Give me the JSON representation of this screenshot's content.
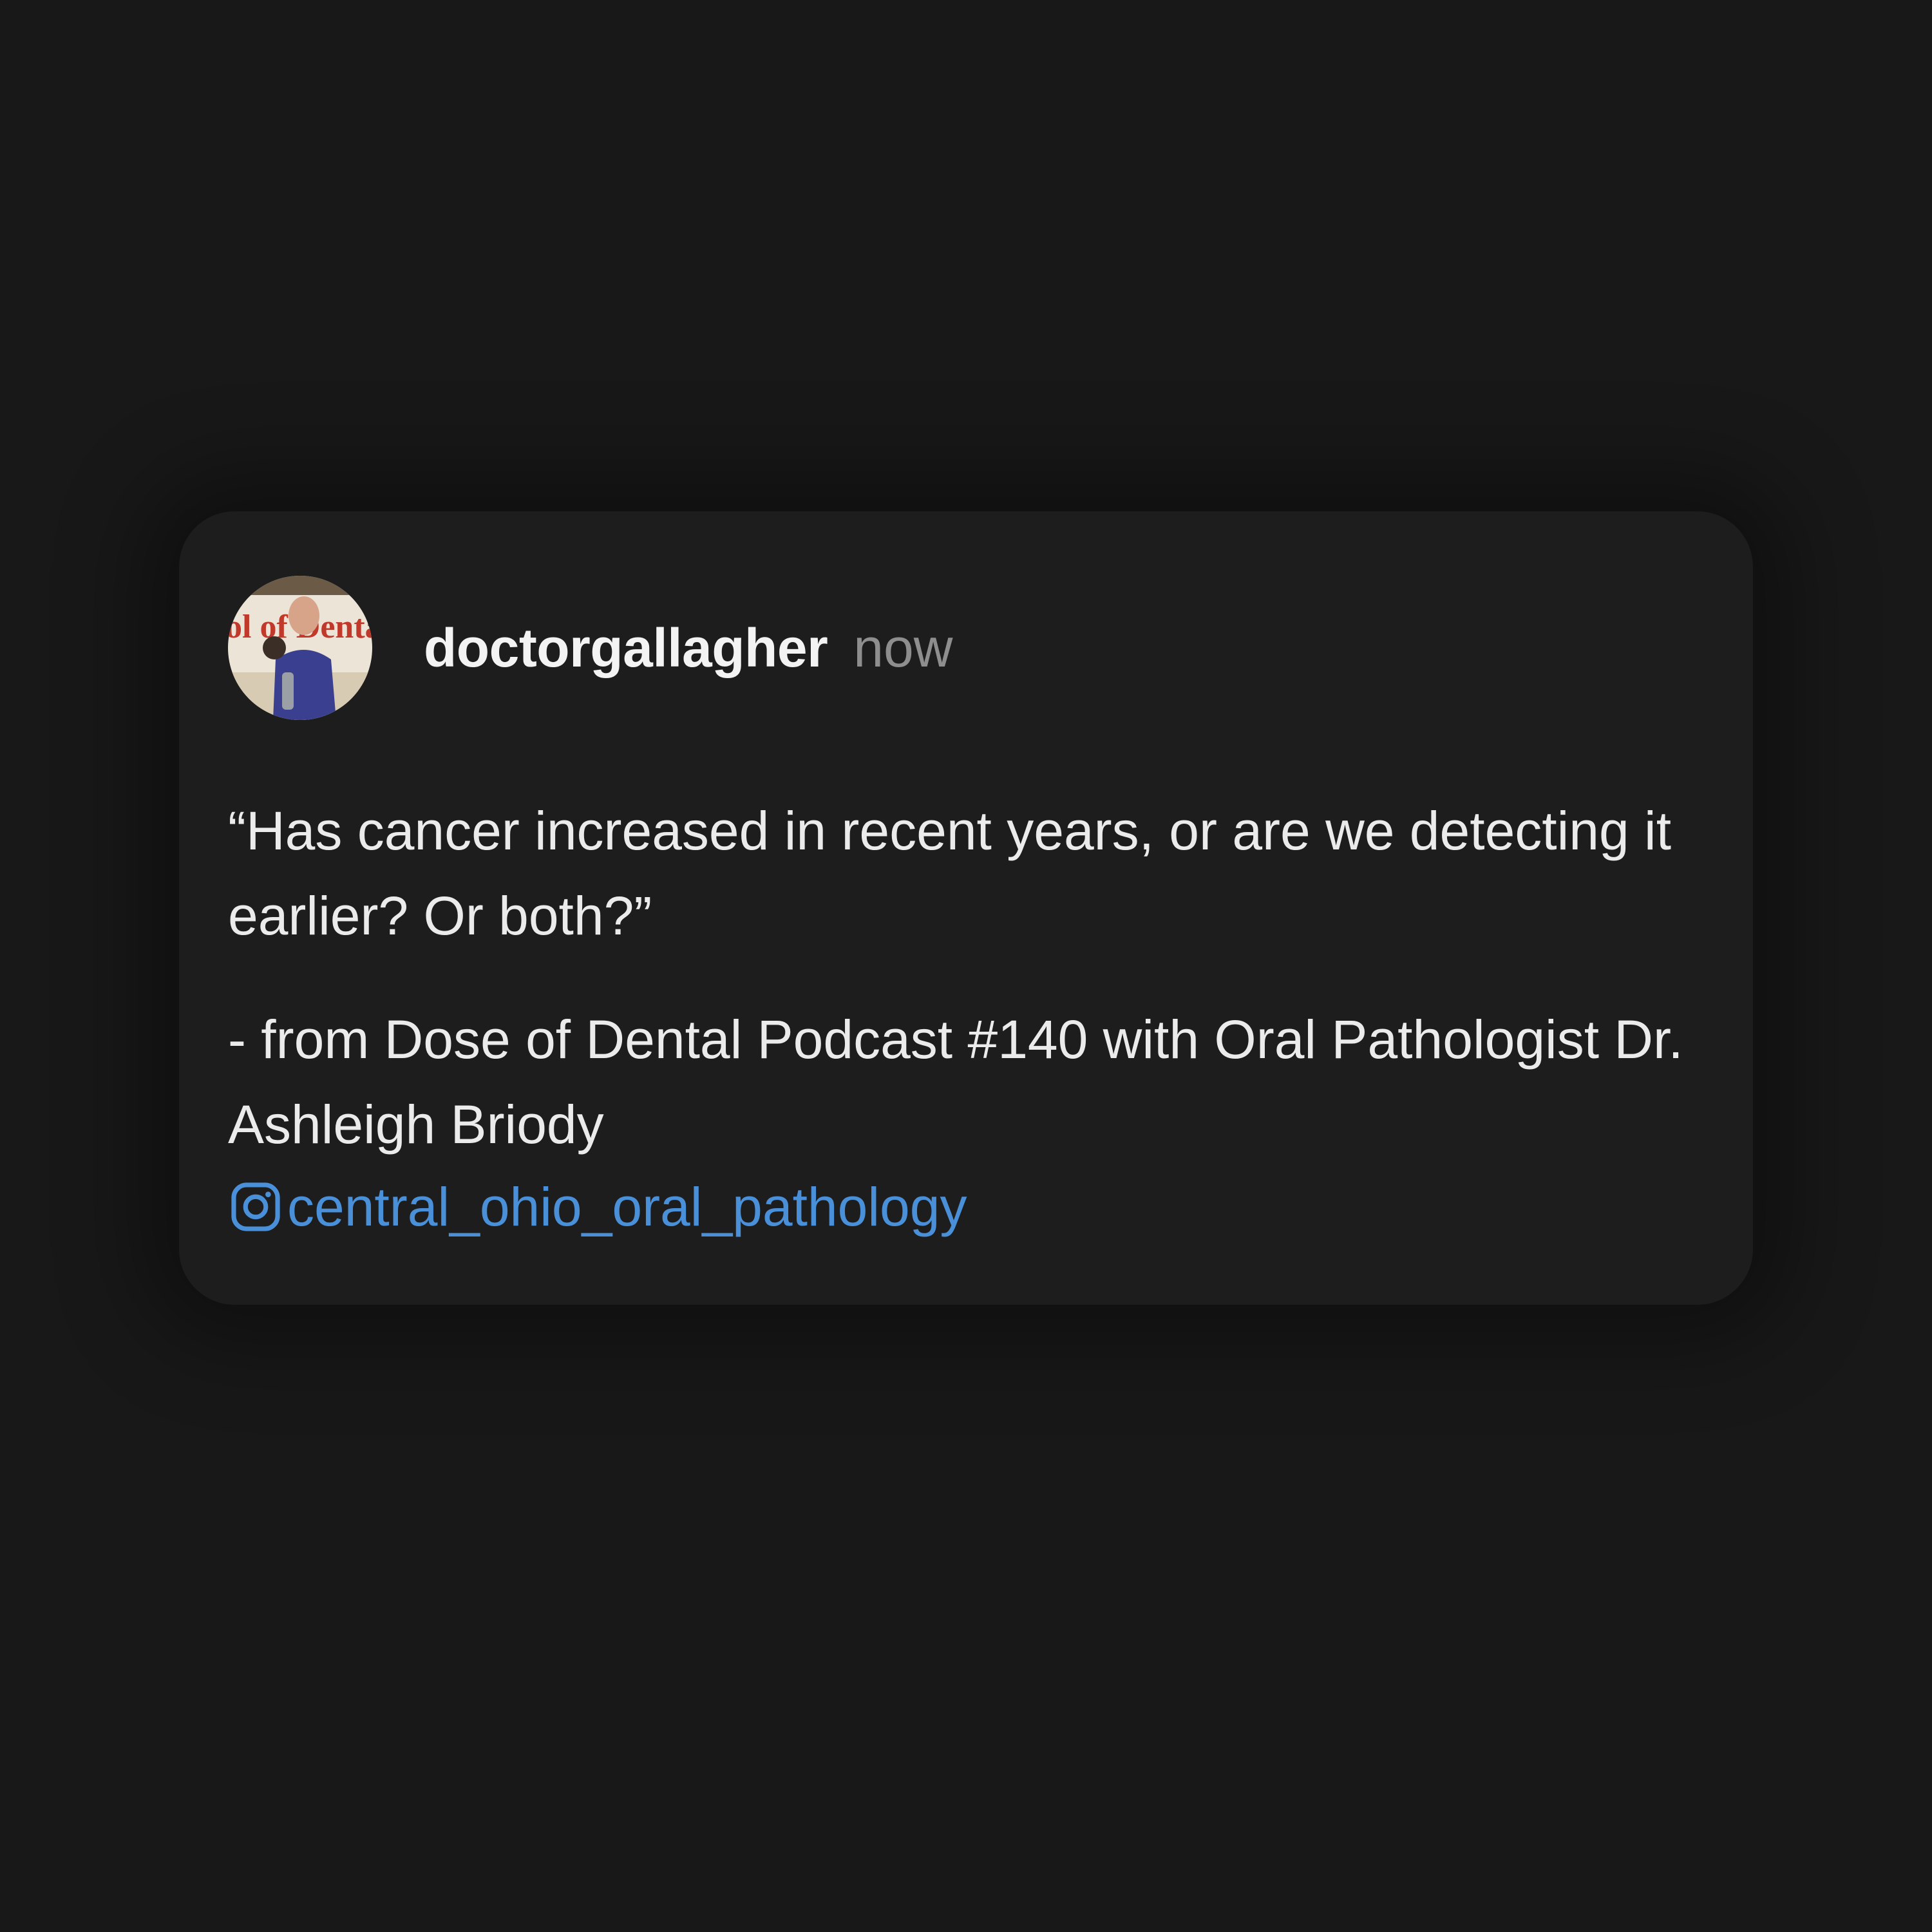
{
  "post": {
    "username": "doctorgallagher",
    "timestamp": "now",
    "avatar_icon": "profile-photo",
    "avatar_sign_text": "ol of Dental",
    "quote": "“Has cancer increased in recent years, or are we detecting it earlier? Or both?”",
    "attribution": "- from Dose of Dental Podcast #140 with Oral Pathologist Dr. Ashleigh Briody",
    "mention": {
      "icon": "instagram-icon",
      "handle": "central_ohio_oral_pathology"
    }
  },
  "colors": {
    "background": "#181818",
    "card": "#1d1d1d",
    "text": "#ebebeb",
    "muted": "#8e8e8e",
    "link": "#4a90d9"
  }
}
